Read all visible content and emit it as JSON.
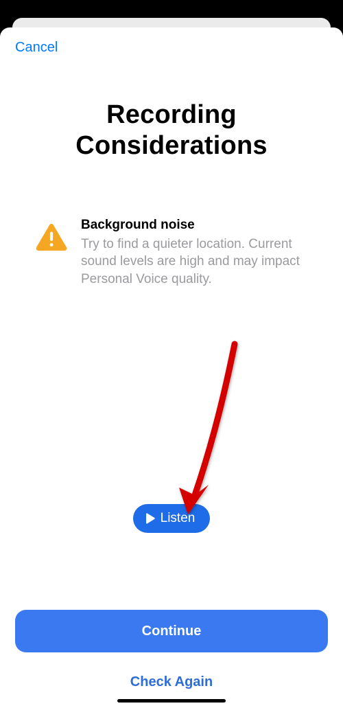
{
  "nav": {
    "cancel_label": "Cancel"
  },
  "page": {
    "title_line1": "Recording",
    "title_line2": "Considerations"
  },
  "consideration": {
    "heading": "Background noise",
    "body": "Try to find a quieter location. Current sound levels are high and may impact Personal Voice quality."
  },
  "listen": {
    "label": "Listen"
  },
  "actions": {
    "continue_label": "Continue",
    "check_again_label": "Check Again"
  },
  "colors": {
    "accent_blue": "#007aff",
    "button_blue": "#3a79f0",
    "pill_blue": "#1f6ce8",
    "warning_orange": "#f5a623",
    "annotation_red": "#d40000"
  }
}
